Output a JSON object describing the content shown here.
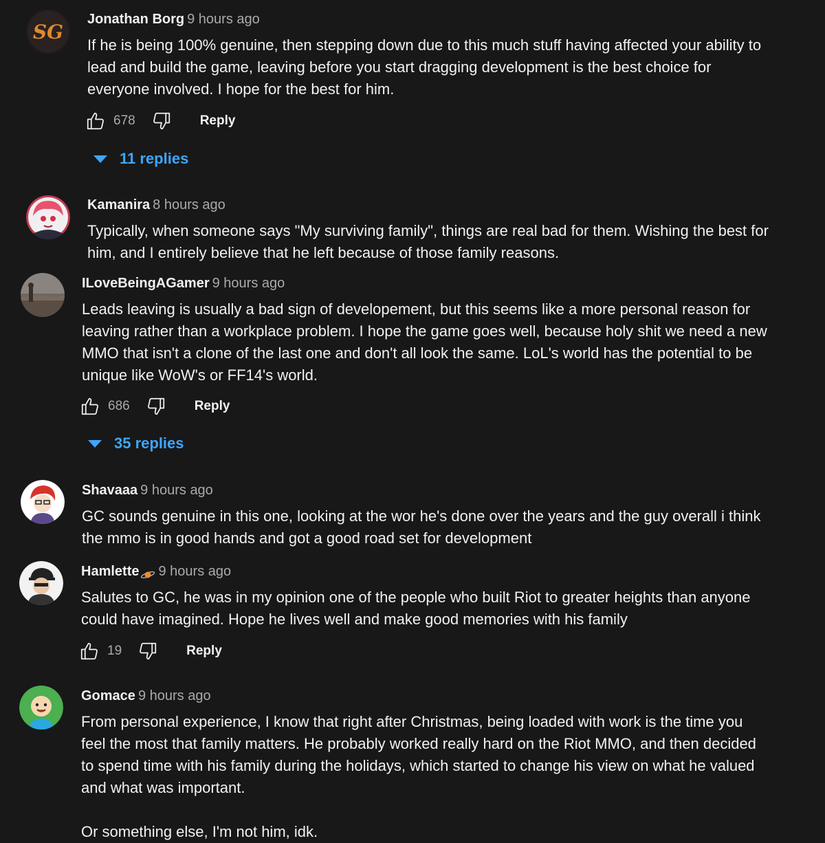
{
  "comments": [
    {
      "author": "Jonathan Borg",
      "time": "9 hours ago",
      "avatar_text": "SG",
      "paragraphs": [
        "If he is being 100% genuine, then stepping down due to this much stuff having affected your ability to lead and build the game, leaving before you start dragging development is the best choice for everyone involved. I hope for the best for him."
      ],
      "likes": "678",
      "reply_label": "Reply",
      "replies_label": "11 replies"
    },
    {
      "author": "Kamanira",
      "time": "8 hours ago",
      "paragraphs": [
        "Typically, when someone says \"My surviving family\", things are real bad for them. Wishing the best for him, and I entirely believe that he left because of those family reasons."
      ]
    },
    {
      "author": "ILoveBeingAGamer",
      "time": "9 hours ago",
      "paragraphs": [
        "Leads leaving is usually a bad sign of developement, but this seems like a more personal reason for leaving rather than a workplace problem. I hope the game goes well, because holy shit we need a new MMO that isn't a clone of the last one and don't all look the same. LoL's world has the potential to be unique like WoW's or FF14's world."
      ],
      "likes": "686",
      "reply_label": "Reply",
      "replies_label": "35 replies"
    },
    {
      "author": "Shavaaa",
      "time": "9 hours ago",
      "paragraphs": [
        "GC sounds genuine in this one, looking at the wor he's done over the years and the guy overall i think the mmo is in good hands and got a good road set for development"
      ]
    },
    {
      "author": "Hamlette",
      "time": "9 hours ago",
      "badge_icon": "planet-icon",
      "paragraphs": [
        "Salutes to GC, he was in my opinion one of the people who built Riot to greater heights than anyone could have imagined. Hope he lives well and make good memories with his family"
      ],
      "likes": "19",
      "reply_label": "Reply"
    },
    {
      "author": "Gomace",
      "time": "9 hours ago",
      "paragraphs": [
        "From personal experience, I know that right after Christmas, being loaded with work is the time you feel the most that family matters. He probably worked really hard on the Riot MMO, and then decided to spend time with his family during the holidays, which started to change his view on what he valued and what was important.",
        "Or something else, I'm not him, idk."
      ]
    }
  ],
  "colors": {
    "background": "#181818",
    "text": "#f1f1f1",
    "secondary": "#aaaaaa",
    "link": "#3ea6ff"
  }
}
